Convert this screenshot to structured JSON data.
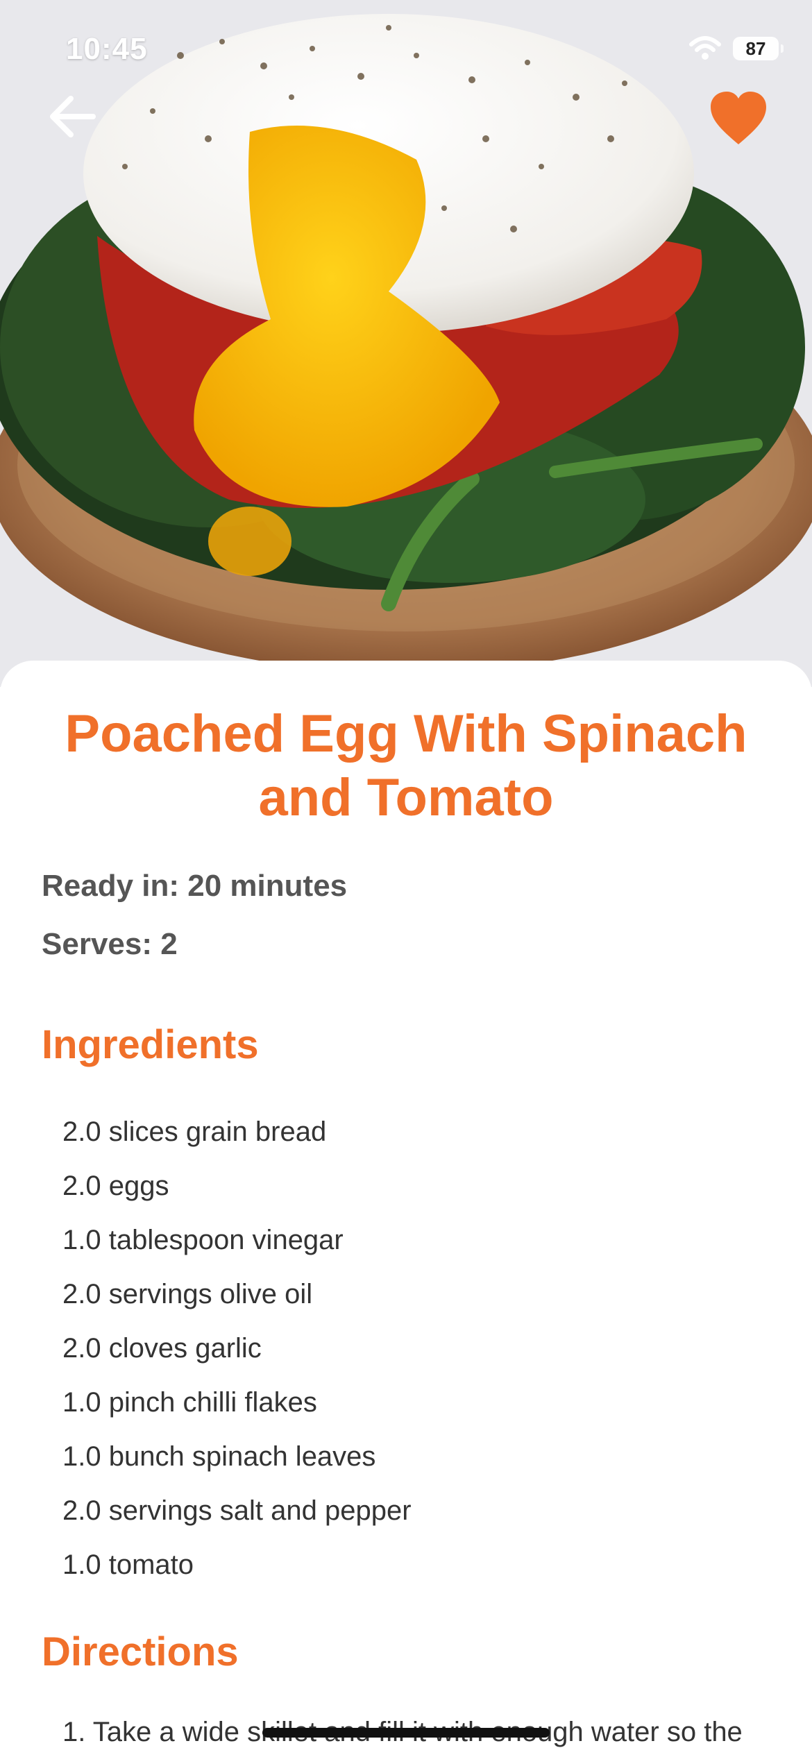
{
  "status_bar": {
    "time": "10:45",
    "battery": "87"
  },
  "nav": {
    "back_icon": "arrow-left-icon",
    "favorite_icon": "heart-icon",
    "accent_color": "#F0702A"
  },
  "hero_image": {
    "description_icon": "food-photo"
  },
  "recipe": {
    "title": "Poached Egg With Spinach and Tomato",
    "ready_in": "Ready in: 20 minutes",
    "serves": "Serves: 2",
    "ingredients_heading": "Ingredients",
    "ingredients": [
      "2.0 slices grain bread",
      "2.0 eggs",
      "1.0 tablespoon vinegar",
      "2.0 servings olive oil",
      "2.0 cloves garlic",
      "1.0 pinch chilli flakes",
      "1.0 bunch spinach leaves",
      "2.0 servings salt and pepper",
      "1.0 tomato"
    ],
    "directions_heading": "Directions",
    "directions": [
      "1. Take a wide skillet and fill it with enough water so the"
    ]
  }
}
